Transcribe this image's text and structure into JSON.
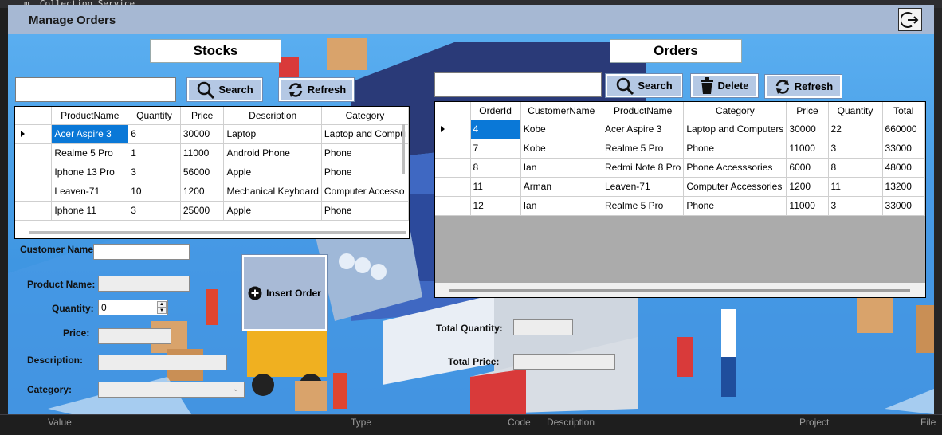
{
  "ide": {
    "top_text": "m  Collection Service",
    "bottom_col1": "Value",
    "bottom_col2": "Type",
    "bottom_col3": "Code",
    "bottom_col4": "Description",
    "bottom_col5": "Project",
    "bottom_col6": "File"
  },
  "window": {
    "title": "Manage Orders"
  },
  "stocks": {
    "header": "Stocks",
    "search_value": "",
    "search_label": "Search",
    "refresh_label": "Refresh",
    "columns": [
      "ProductName",
      "Quantity",
      "Price",
      "Description",
      "Category"
    ],
    "rows": [
      [
        "Acer Aspire 3",
        "6",
        "30000",
        "Laptop",
        "Laptop and Compu"
      ],
      [
        "Realme 5 Pro",
        "1",
        "11000",
        "Android Phone",
        "Phone"
      ],
      [
        "Iphone 13 Pro",
        "3",
        "56000",
        "Apple",
        "Phone"
      ],
      [
        "Leaven-71",
        "10",
        "1200",
        "Mechanical Keyboard",
        "Computer Accesso"
      ],
      [
        "Iphone 11",
        "3",
        "25000",
        "Apple",
        "Phone"
      ]
    ]
  },
  "form": {
    "customer_name_label": "Customer Name:",
    "product_name_label": "Product Name:",
    "quantity_label": "Quantity:",
    "quantity_value": "0",
    "price_label": "Price:",
    "description_label": "Description:",
    "category_label": "Category:",
    "insert_label": "Insert Order"
  },
  "orders": {
    "header": "Orders",
    "search_value": "",
    "search_label": "Search",
    "delete_label": "Delete",
    "refresh_label": "Refresh",
    "columns": [
      "OrderId",
      "CustomerName",
      "ProductName",
      "Category",
      "Price",
      "Quantity",
      "Total"
    ],
    "rows": [
      [
        "4",
        "Kobe",
        "Acer Aspire 3",
        "Laptop and Computers",
        "30000",
        "22",
        "660000"
      ],
      [
        "7",
        "Kobe",
        "Realme 5 Pro",
        "Phone",
        "11000",
        "3",
        "33000"
      ],
      [
        "8",
        "Ian",
        "Redmi Note 8 Pro",
        "Phone Accesssories",
        "6000",
        "8",
        "48000"
      ],
      [
        "11",
        "Arman",
        "Leaven-71",
        "Computer Accessories",
        "1200",
        "11",
        "13200"
      ],
      [
        "12",
        "Ian",
        "Realme 5 Pro",
        "Phone",
        "11000",
        "3",
        "33000"
      ]
    ],
    "total_quantity_label": "Total Quantity:",
    "total_price_label": "Total Price:"
  },
  "icons": {
    "exit": "logout-icon",
    "search": "magnifier-icon",
    "refresh": "refresh-icon",
    "delete": "trash-icon",
    "insert": "plus-circle-icon"
  },
  "colors": {
    "titlebar": "#a6b8d3",
    "button": "#b4c8e4",
    "selection": "#0a78d7",
    "background": "#3b8edb"
  }
}
